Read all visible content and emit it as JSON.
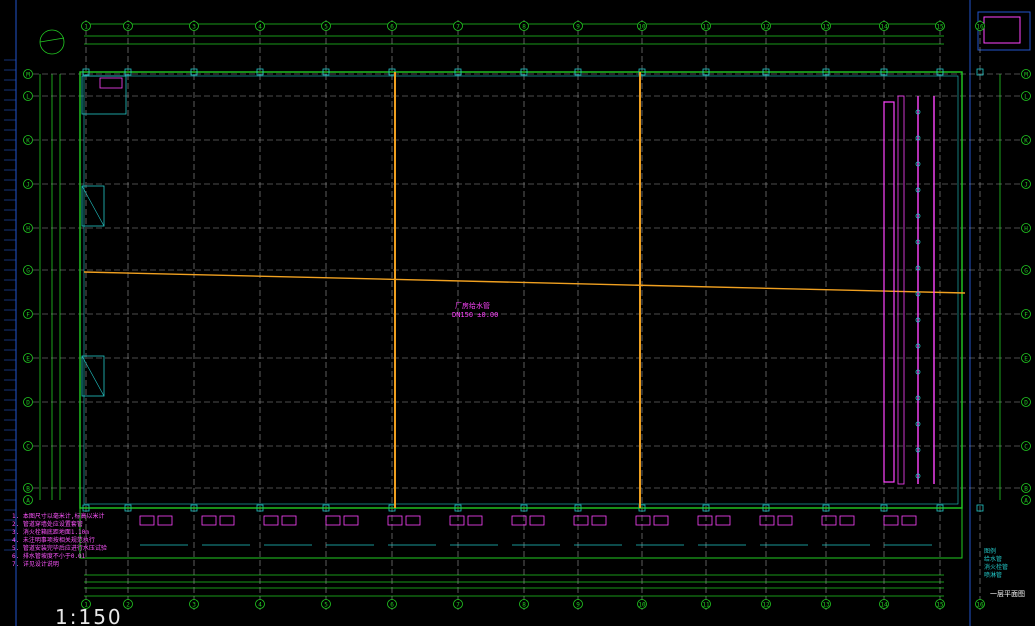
{
  "colors": {
    "background": "#000000",
    "grid": "#9a9a9a",
    "axis": "#22cc22",
    "wall": "#22cc22",
    "pipe_orange": "#f0a020",
    "equipment_magenta": "#ff44ff",
    "cyan": "#22c8c8",
    "frame_blue": "#2255cc",
    "notes_magenta": "#ff55ff"
  },
  "drawing": {
    "col_labels": [
      "1",
      "2",
      "3",
      "4",
      "5",
      "6",
      "7",
      "8",
      "9",
      "10",
      "11",
      "12",
      "13",
      "14",
      "15",
      "16",
      "17",
      "18"
    ],
    "row_labels": [
      "M",
      "L",
      "K",
      "J",
      "H",
      "G",
      "F",
      "E",
      "D",
      "C",
      "B",
      "A"
    ],
    "scale_text": "1:150",
    "sheet_label": "一层平面图",
    "legend_title": "图例",
    "legend_items": [
      "给水管",
      "消火栓管",
      "喷淋管"
    ],
    "notes_lines": [
      "1. 本图尺寸以毫米计,标高以米计",
      "2. 管道穿墙处应设置套管",
      "3. 消火栓箱底距地面1.10m",
      "4. 未注明事项按相关规范执行",
      "5. 管道安装完毕后应进行水压试验",
      "6. 排水管坡度不小于0.01",
      "7. 详见设计说明"
    ],
    "main_annot": "厂房给水管",
    "main_annot_2": "DN150 ±0.00"
  }
}
